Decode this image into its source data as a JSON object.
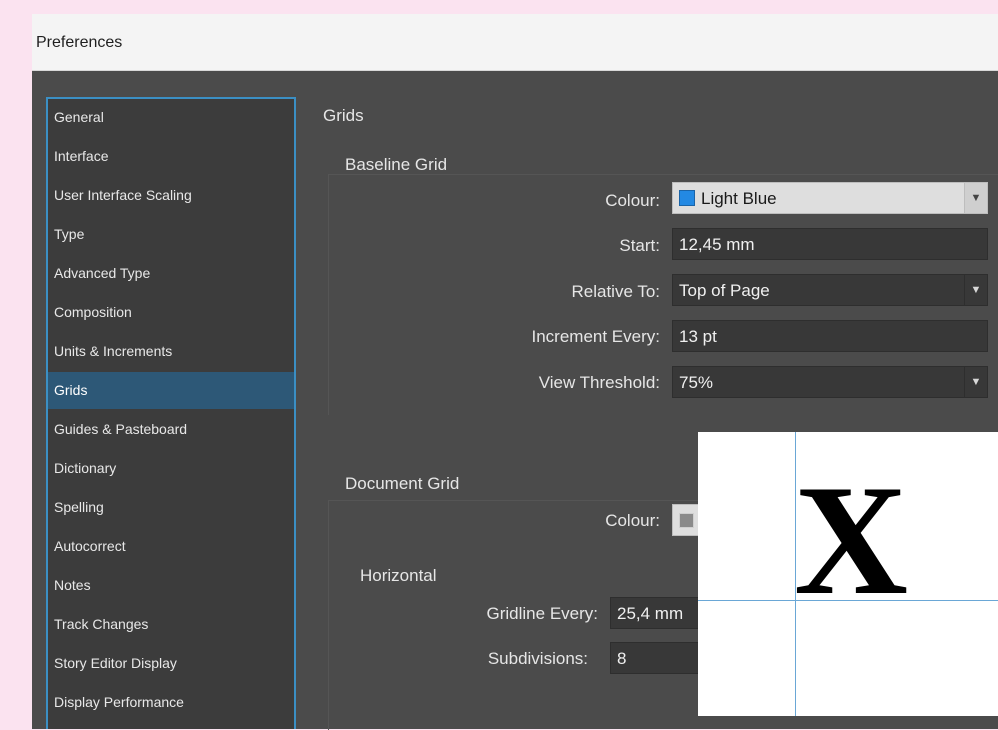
{
  "window": {
    "title": "Preferences"
  },
  "sidebar": {
    "items": [
      {
        "label": "General"
      },
      {
        "label": "Interface"
      },
      {
        "label": "User Interface Scaling"
      },
      {
        "label": "Type"
      },
      {
        "label": "Advanced Type"
      },
      {
        "label": "Composition"
      },
      {
        "label": "Units & Increments"
      },
      {
        "label": "Grids",
        "selected": true
      },
      {
        "label": "Guides & Pasteboard"
      },
      {
        "label": "Dictionary"
      },
      {
        "label": "Spelling"
      },
      {
        "label": "Autocorrect"
      },
      {
        "label": "Notes"
      },
      {
        "label": "Track Changes"
      },
      {
        "label": "Story Editor Display"
      },
      {
        "label": "Display Performance"
      }
    ]
  },
  "main": {
    "section_title": "Grids",
    "baseline_grid": {
      "title": "Baseline Grid",
      "colour_label": "Colour:",
      "colour_value": "Light Blue",
      "colour_swatch": "#2389e3",
      "start_label": "Start:",
      "start_value": "12,45 mm",
      "relative_to_label": "Relative To:",
      "relative_to_value": "Top of Page",
      "increment_label": "Increment Every:",
      "increment_value": "13 pt",
      "view_threshold_label": "View Threshold:",
      "view_threshold_value": "75%"
    },
    "document_grid": {
      "title": "Document Grid",
      "colour_label": "Colour:",
      "horizontal_title": "Horizontal",
      "gridline_label": "Gridline Every:",
      "gridline_value": "25,4 mm",
      "subdivisions_label": "Subdivisions:",
      "subdivisions_value": "8"
    }
  },
  "overlay": {
    "letter": "X"
  },
  "colors": {
    "accent": "#3b8fc4",
    "selection": "#2d5877",
    "panel": "#4b4b4b"
  },
  "icons": {
    "dropdown": "chevron-down-icon"
  }
}
